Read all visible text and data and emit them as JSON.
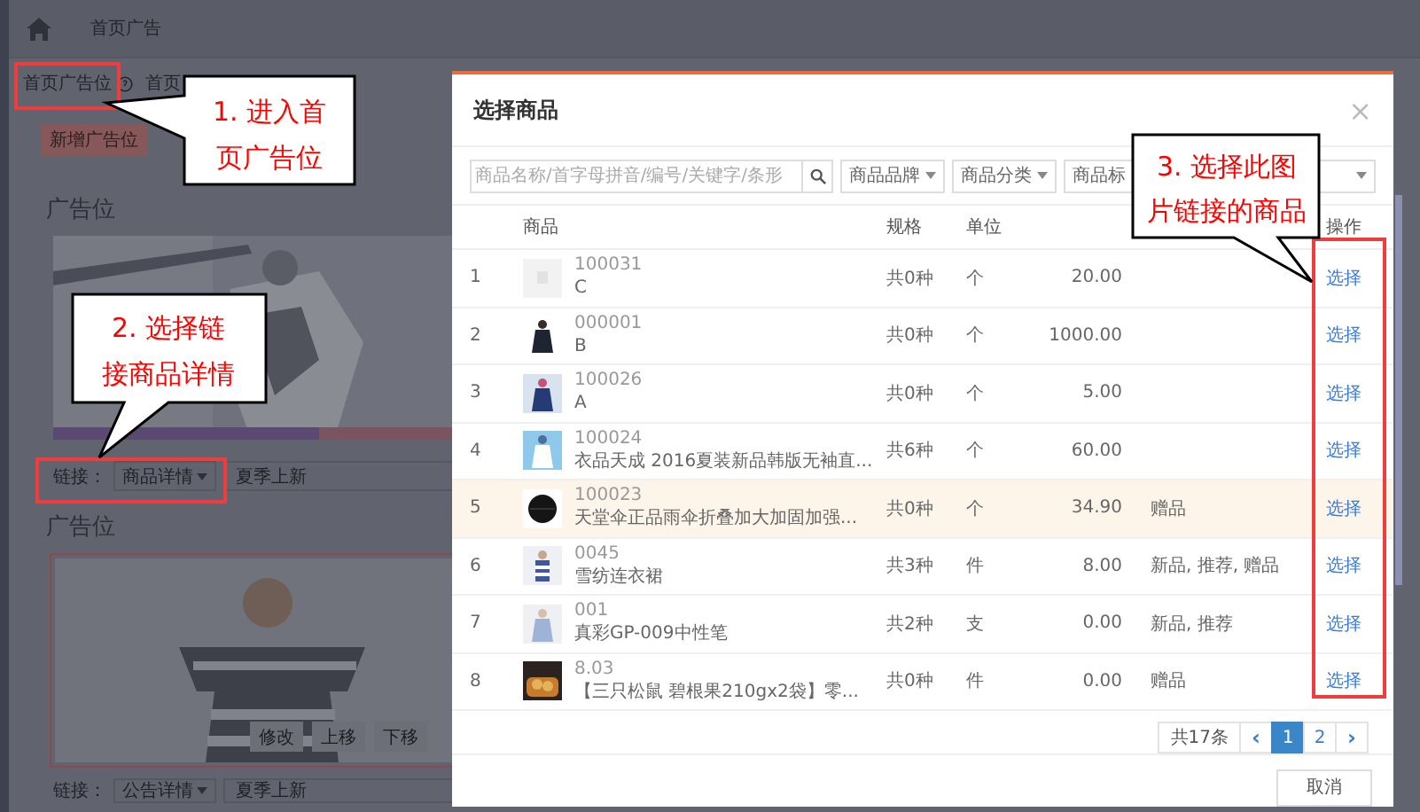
{
  "nav": {
    "tab": "首页广告"
  },
  "breadcrumbs": [
    "首页广告位",
    "首页"
  ],
  "add_button": "新增广告位",
  "ad_slots": [
    {
      "title": "广告位",
      "link_label": "链接：",
      "link_type": "商品详情",
      "link_target": "夏季上新"
    },
    {
      "title": "广告位",
      "actions": [
        "修改",
        "上移",
        "下移"
      ],
      "link_label": "链接：",
      "link_type": "公告详情",
      "link_target": "夏季上新"
    }
  ],
  "modal": {
    "title": "选择商品",
    "close": "×",
    "filters": [
      {
        "kind": "search",
        "placeholder": "商品名称/首字母拼音/编号/关键字/条形"
      },
      {
        "kind": "select",
        "label": "商品品牌"
      },
      {
        "kind": "select",
        "label": "商品分类"
      },
      {
        "kind": "select",
        "label": "商品标"
      },
      {
        "kind": "select"
      }
    ],
    "columns": [
      "商品",
      "规格",
      "单位",
      "操作"
    ],
    "rows": [
      {
        "index": "1",
        "thumbnail": {
          "kind": "placeholder"
        },
        "code": "100031",
        "name": "C",
        "spec": "共0种",
        "unit": "个",
        "price": "20.00",
        "action": "选择",
        "highlighted": false
      },
      {
        "index": "2",
        "code": "000001",
        "name": "B",
        "spec": "共0种",
        "unit": "个",
        "price": "1000.00",
        "action": "选择",
        "highlighted": false
      },
      {
        "index": "3",
        "code": "100026",
        "name": "A",
        "spec": "共0种",
        "unit": "个",
        "price": "5.00",
        "action": "选择",
        "highlighted": false
      },
      {
        "index": "4",
        "code": "100024",
        "name": "衣品天成 2016夏装新品韩版无袖直...",
        "spec": "共6种",
        "unit": "个",
        "price": "60.00",
        "action": "选择",
        "highlighted": false
      },
      {
        "index": "5",
        "code": "100023",
        "name": "天堂伞正品雨伞折叠加大加固加强...",
        "spec": "共0种",
        "unit": "个",
        "price": "34.90",
        "tags": "赠品",
        "action": "选择",
        "highlighted": true
      },
      {
        "index": "6",
        "code": "0045",
        "name": "雪纺连衣裙",
        "spec": "共3种",
        "unit": "件",
        "price": "8.00",
        "tags": "新品, 推荐, 赠品",
        "action": "选择",
        "highlighted": false
      },
      {
        "index": "7",
        "code": "001",
        "name": "真彩GP-009中性笔",
        "spec": "共2种",
        "unit": "支",
        "price": "0.00",
        "tags": "新品, 推荐",
        "action": "选择",
        "highlighted": false
      },
      {
        "index": "8",
        "code": "8.03",
        "name": "【三只松鼠 碧根果210gx2袋】零...",
        "spec": "共0种",
        "unit": "件",
        "price": "0.00",
        "tags": "赠品",
        "action": "选择",
        "highlighted": false
      }
    ],
    "pagination": {
      "total": "共17条",
      "prev": "‹",
      "pages": [
        {
          "label": "1",
          "selected": true
        },
        {
          "label": "2",
          "selected": false
        }
      ],
      "next": "›"
    },
    "cancel_button": "取消"
  },
  "annotations": [
    {
      "lines": [
        "1. 进入首",
        "页广告位"
      ]
    },
    {
      "lines": [
        "2. 选择链",
        "接商品详情"
      ]
    },
    {
      "lines": [
        "3. 选择此图",
        "片链接的商品"
      ]
    }
  ]
}
